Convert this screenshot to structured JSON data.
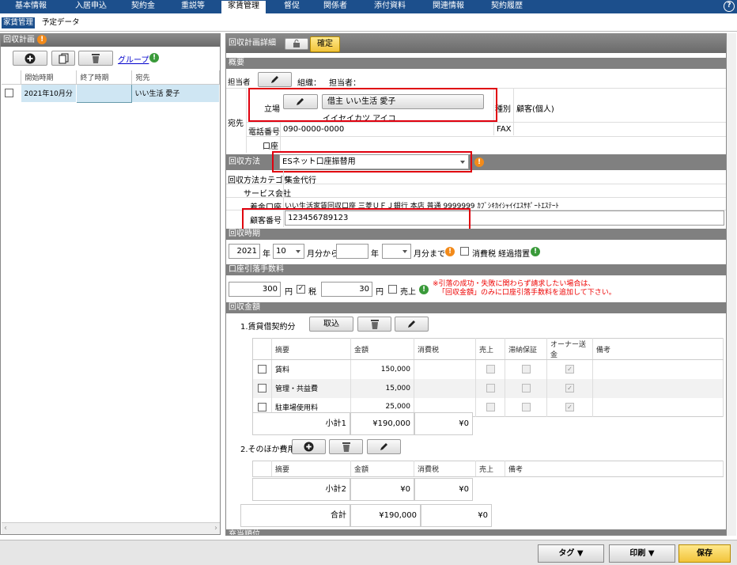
{
  "top_tabs": [
    "基本情報",
    "入居申込",
    "契約金",
    "重説等",
    "家賃管理",
    "督促",
    "関係者",
    "添付資料",
    "関連情報",
    "契約履歴"
  ],
  "sub_tabs": [
    "家賃管理",
    "予定データ"
  ],
  "left": {
    "title": "回収計画",
    "group_link": "グループ",
    "columns": [
      "開始時期",
      "終了時期",
      "宛先"
    ],
    "rows": [
      {
        "start": "2021年10月分",
        "end": "",
        "dest": "いい生活 愛子"
      }
    ]
  },
  "detail": {
    "title": "回収計画詳細",
    "confirm": "確定",
    "overview": "概要",
    "tantosha_label": "担当者",
    "org_label": "組織：",
    "tanto_label": "担当者：",
    "dest_label": "宛先",
    "position_label": "立場",
    "position_value": "借主 いい生活 愛子",
    "kana": "イイセイカツ アイコ",
    "type_label": "種別",
    "type_value": "顧客(個人)",
    "tel_label": "電話番号",
    "tel_value": "090-0000-0000",
    "fax_label": "FAX",
    "account_label": "口座"
  },
  "method": {
    "section": "回収方法",
    "value": "ESネット口座振替用",
    "category_label": "回収方法カテゴリ",
    "category_value": "集金代行",
    "service_label": "サービス会社",
    "deposit_label": "着金口座",
    "deposit_value": "いい生活家賃回収口座 三菱ＵＦＪ銀行 本店 普通 9999999 ｶﾌﾞｼｷｶｲｼｬｲｲｴｽｻﾎﾟｰﾄｴｽﾃｰﾄ",
    "customer_no_label": "顧客番号",
    "customer_no_value": "123456789123"
  },
  "period": {
    "section": "回収時期",
    "year": "2021",
    "year_label": "年",
    "month": "10",
    "month_from": "月分から",
    "year2_label": "年",
    "month_to": "月分まで",
    "tax_label": "消費税 経過措置"
  },
  "fee": {
    "section": "口座引落手数料",
    "amount": "300",
    "yen": "円",
    "tax_label": "税",
    "tax_amount": "30",
    "yen2": "円",
    "sales_label": "売上",
    "note1": "※引落の成功・失敗に関わらず請求したい場合は、",
    "note2": "「回収金額」のみに口座引落手数料を追加して下さい。"
  },
  "amount": {
    "section": "回収金額",
    "rent_part": "1.賃貸借契約分",
    "take_in": "取込",
    "columns": [
      "摘要",
      "金額",
      "消費税",
      "売上",
      "滞納保証",
      "オーナー送金",
      "備考"
    ],
    "rows": [
      {
        "name": "賃料",
        "amount": "150,000",
        "tax": ""
      },
      {
        "name": "管理・共益費",
        "amount": "15,000",
        "tax": ""
      },
      {
        "name": "駐車場使用料",
        "amount": "25,000",
        "tax": ""
      }
    ],
    "subtotal1_label": "小計1",
    "subtotal1_amount": "¥190,000",
    "subtotal1_tax": "¥0",
    "other_part": "2.そのほか費用",
    "other_columns": [
      "摘要",
      "金額",
      "消費税",
      "売上",
      "備考"
    ],
    "subtotal2_label": "小計2",
    "subtotal2_amount": "¥0",
    "subtotal2_tax": "¥0",
    "total_label": "合計",
    "total_amount": "¥190,000",
    "total_tax": "¥0",
    "cut_section": "充当順位"
  },
  "bottom": {
    "tag": "タグ ▼",
    "print": "印刷 ▼",
    "save": "保存"
  }
}
